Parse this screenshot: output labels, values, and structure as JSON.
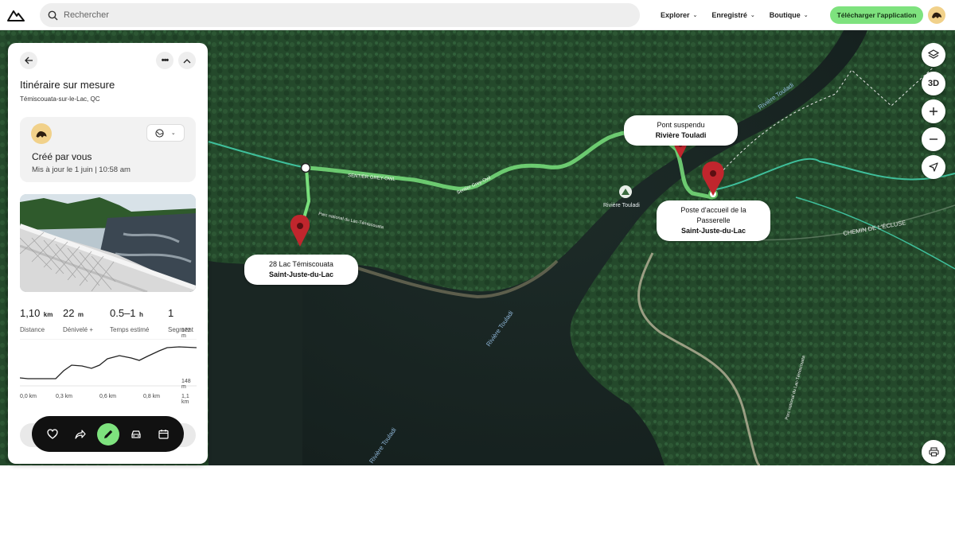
{
  "header": {
    "search_placeholder": "Rechercher",
    "nav": [
      {
        "label": "Explorer"
      },
      {
        "label": "Enregistré"
      },
      {
        "label": "Boutique"
      }
    ],
    "cta_label": "Télécharger l'application"
  },
  "panel": {
    "title": "Itinéraire sur mesure",
    "location": "Témiscouata-sur-le-Lac, QC",
    "creator": {
      "created_label": "Créé par vous",
      "updated_label": "Mis à jour le 1 juin | 10:58 am"
    },
    "stats": [
      {
        "value": "1,10",
        "unit": "km",
        "label": "Distance"
      },
      {
        "value": "22",
        "unit": "m",
        "label": "Dénivelé +"
      },
      {
        "value": "0.5–1",
        "unit": "h",
        "label": "Temps estimé"
      },
      {
        "value": "1",
        "unit": "",
        "label": "Segment"
      }
    ],
    "profile": {
      "max_label": "172 m",
      "min_label": "148 m",
      "x_labels": [
        "0,0 km",
        "0,3 km",
        "0,6 km",
        "0,8 km",
        "1,1 km"
      ]
    }
  },
  "map": {
    "pins": [
      {
        "line1": "28 Lac Témiscouata",
        "line2": "Saint-Juste-du-Lac"
      },
      {
        "line1": "Pont suspendu",
        "line2": "Rivière Touladi"
      },
      {
        "line1": "Poste d'accueil de la Passerelle",
        "line2": "Saint-Juste-du-Lac"
      }
    ],
    "labels": {
      "trail": "SENTIER GREY-OWL",
      "trail2": "Sentier Grey-Owl",
      "river1": "Rivière Touladi",
      "river2": "Rivière Touladi",
      "river3": "Rivière Touladi",
      "river4": "Rivière Touladi",
      "park": "Parc national du Lac-Témiscouata",
      "park2": "Parc national du Lac-Témiscouata",
      "road": "CHEMIN DE L'ÉCLUSE"
    },
    "controls": {
      "threed": "3D"
    }
  },
  "colors": {
    "accent": "#7ee27e",
    "pin": "#c0262d",
    "route": "#6fdc73"
  }
}
